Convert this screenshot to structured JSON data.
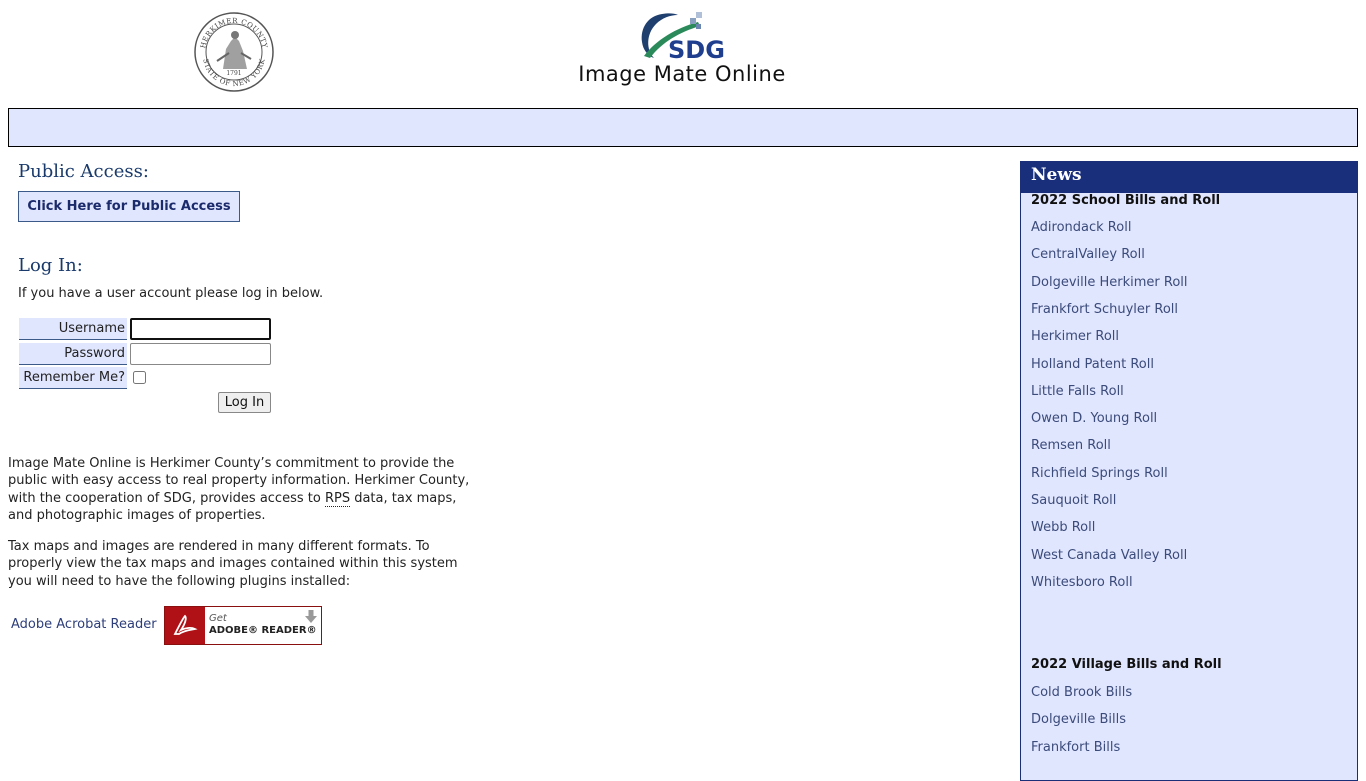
{
  "header": {
    "seal_text": [
      "HERKIMER COUNTY",
      "STATE OF NEW YORK",
      "1791"
    ],
    "sdg_logo_text": "SDG",
    "title": "Image Mate Online"
  },
  "public_access": {
    "title": "Public Access:",
    "button_label": "Click Here for Public Access"
  },
  "login": {
    "title": "Log In:",
    "help": "If you have a user account please log in below.",
    "username_label": "Username",
    "password_label": "Password",
    "remember_label": "Remember Me?",
    "username_value": "",
    "password_value": "",
    "remember_checked": false,
    "submit_label": "Log In"
  },
  "intro": {
    "p1_before": "Image Mate Online is Herkimer County’s commitment to provide the public with easy access to real property information. Herkimer County, with the cooperation of SDG, provides access to ",
    "p1_abbr": "RPS",
    "p1_after": " data, tax maps, and photographic images of properties.",
    "p2": "Tax maps and images are rendered in many different formats. To properly view the tax maps and images contained within this system you will need to have the following plugins installed:",
    "acrobat_link": "Adobe Acrobat Reader",
    "adobe_badge_get": "Get",
    "adobe_badge_product": "ADOBE® READER®"
  },
  "news": {
    "title": "News",
    "school_heading": "2022 School Bills and Roll",
    "school_links": [
      "Adirondack Roll",
      "CentralValley Roll",
      "Dolgeville Herkimer Roll",
      "Frankfort Schuyler Roll",
      "Herkimer Roll",
      "Holland Patent Roll",
      "Little Falls Roll",
      "Owen D. Young Roll",
      "Remsen Roll",
      "Richfield Springs Roll",
      "Sauquoit Roll",
      "Webb Roll",
      "West Canada Valley Roll",
      "Whitesboro Roll"
    ],
    "village_heading": "2022 Village Bills and Roll",
    "village_links": [
      "Cold Brook Bills",
      "Dolgeville Bills",
      "Frankfort Bills"
    ]
  },
  "colors": {
    "panel_bg": "#e1e6ff",
    "news_header_bg": "#192f7c",
    "link": "#3b4b7a",
    "title_blue": "#1a3a6b"
  }
}
